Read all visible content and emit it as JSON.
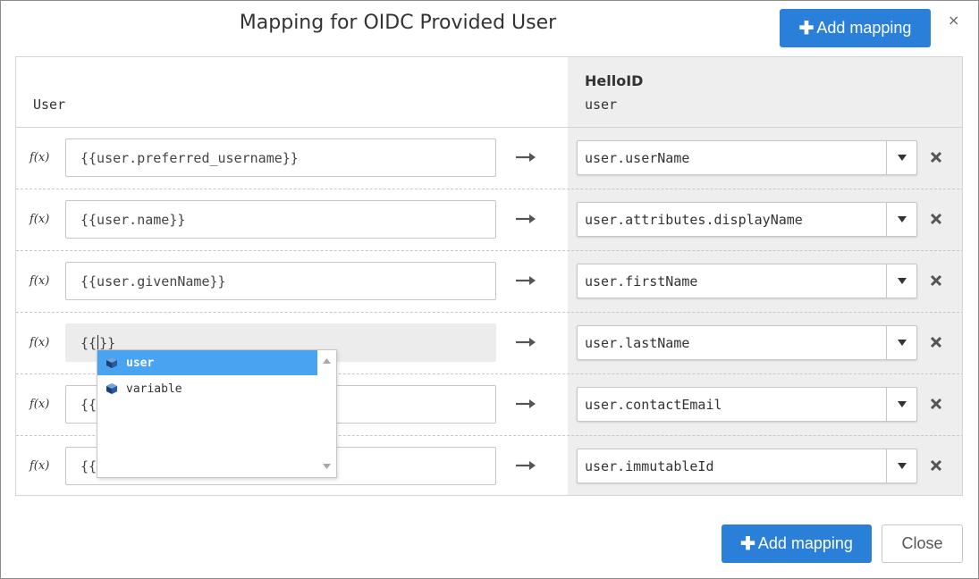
{
  "dialog": {
    "title": "Mapping for OIDC Provided User",
    "add_mapping_label": "Add mapping",
    "close_icon": "×",
    "close_label": "Close"
  },
  "header": {
    "left_label": "User",
    "right_title": "HelloID",
    "right_subtitle": "user"
  },
  "fx_label": "f(x)",
  "rows": [
    {
      "source": "{{user.preferred_username}}",
      "target": "user.userName"
    },
    {
      "source": "{{user.name}}",
      "target": "user.attributes.displayName"
    },
    {
      "source": "{{user.givenName}}",
      "target": "user.firstName"
    },
    {
      "source_before_caret": "{{",
      "source_after_caret": "}}",
      "target": "user.lastName"
    },
    {
      "source": "{{",
      "target": "user.contactEmail"
    },
    {
      "source": "{{",
      "target": "user.immutableId"
    }
  ],
  "autocomplete": {
    "items": [
      {
        "label": "user",
        "icon": "cube-icon",
        "selected": true
      },
      {
        "label": "variable",
        "icon": "cube-icon",
        "selected": false
      }
    ]
  },
  "colors": {
    "primary": "#2a7fd9",
    "autocomplete_selected": "#4aa3f0",
    "target_column_bg": "#eeeeee"
  }
}
